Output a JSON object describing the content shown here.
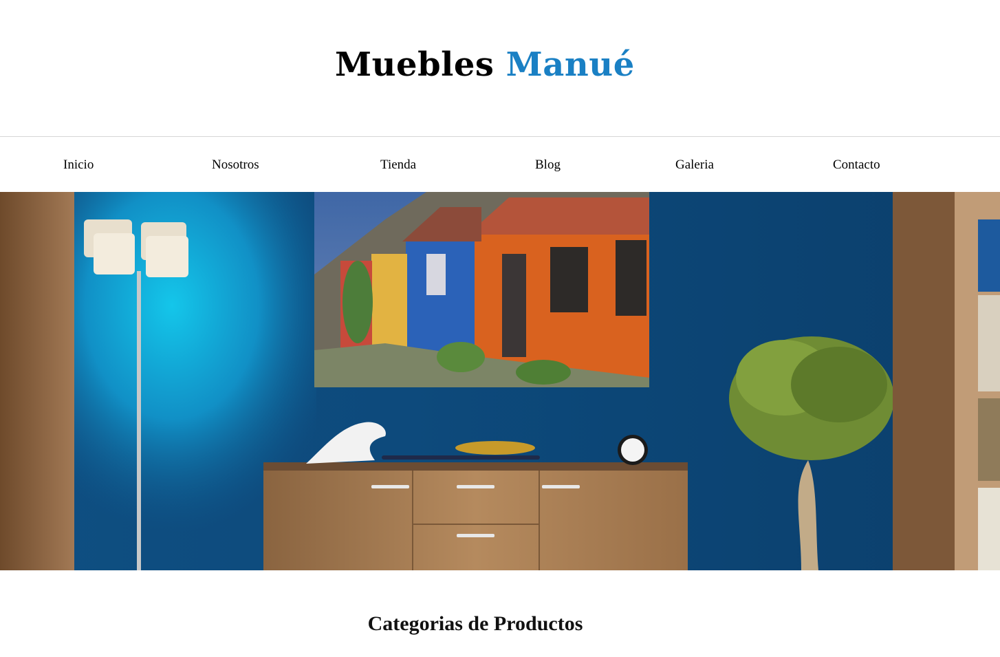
{
  "header": {
    "brand_primary": "Muebles",
    "brand_accent": "Manué",
    "accent_color": "#1a80c4"
  },
  "nav": {
    "items": [
      {
        "label": "Inicio"
      },
      {
        "label": "Nosotros"
      },
      {
        "label": "Tienda"
      },
      {
        "label": "Blog"
      },
      {
        "label": "Galeria"
      },
      {
        "label": "Contacto"
      }
    ]
  },
  "hero": {
    "image": "living-room-photo"
  },
  "main": {
    "section_title": "Categorias de Productos"
  }
}
